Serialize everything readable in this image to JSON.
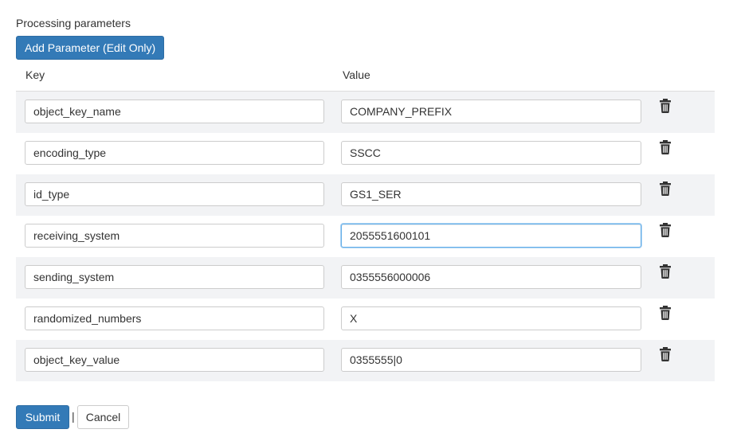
{
  "section_label": "Processing parameters",
  "add_button_label": "Add Parameter (Edit Only)",
  "columns": {
    "key": "Key",
    "value": "Value"
  },
  "parameters": [
    {
      "key": "object_key_name",
      "value": "COMPANY_PREFIX",
      "focused": false
    },
    {
      "key": "encoding_type",
      "value": "SSCC",
      "focused": false
    },
    {
      "key": "id_type",
      "value": "GS1_SER",
      "focused": false
    },
    {
      "key": "receiving_system",
      "value": "2055551600101",
      "focused": true
    },
    {
      "key": "sending_system",
      "value": "0355556000006",
      "focused": false
    },
    {
      "key": "randomized_numbers",
      "value": "X",
      "focused": false
    },
    {
      "key": "object_key_value",
      "value": "0355555|0",
      "focused": false
    }
  ],
  "footer": {
    "submit_label": "Submit",
    "separator": "|",
    "cancel_label": "Cancel"
  },
  "icons": {
    "delete": "trash-icon"
  },
  "colors": {
    "primary": "#337ab7",
    "row_stripe": "#f2f3f5",
    "focus_ring": "#66afe9"
  }
}
